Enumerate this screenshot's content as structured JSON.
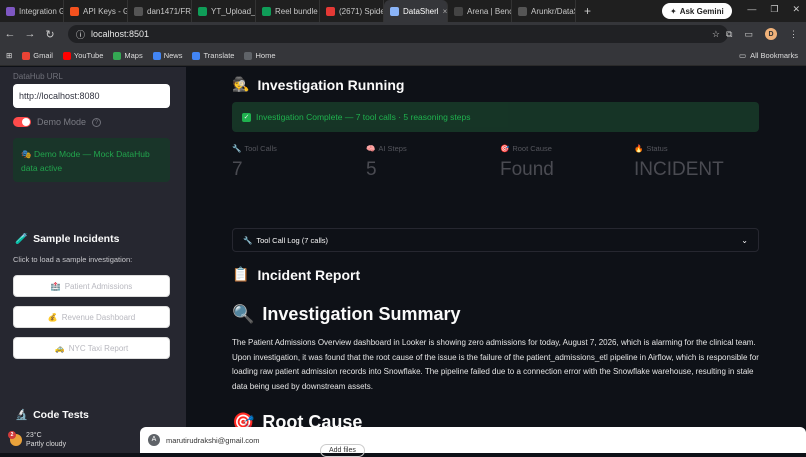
{
  "browser": {
    "tabs": [
      {
        "label": "Integration Gu",
        "color": "#7e57c2"
      },
      {
        "label": "API Keys - Gro",
        "color": "#f4511e"
      },
      {
        "label": "dan1471/FREE",
        "color": "#555555"
      },
      {
        "label": "YT_Upload_Co",
        "color": "#0f9d58"
      },
      {
        "label": "Reel bundle -",
        "color": "#0f9d58"
      },
      {
        "label": "(2671) Spider-",
        "color": "#e53935"
      },
      {
        "label": "DataSherl",
        "color": "#8ab4f8",
        "active": true
      },
      {
        "label": "Arena | Bench",
        "color": "#444444"
      },
      {
        "label": "Arunkr/DataSh",
        "color": "#555555"
      }
    ],
    "new_tab": "+",
    "gemini_label": "Ask Gemini",
    "url": "localhost:8501",
    "profile_initial": "D",
    "bookmarks": [
      {
        "label": "Gmail",
        "color": "#ea4335"
      },
      {
        "label": "YouTube",
        "color": "#ff0000"
      },
      {
        "label": "Maps",
        "color": "#34a853"
      },
      {
        "label": "News",
        "color": "#4285f4"
      },
      {
        "label": "Translate",
        "color": "#4285f4"
      },
      {
        "label": "Home",
        "color": "#5f6368"
      }
    ],
    "all_bookmarks": "All Bookmarks"
  },
  "sidebar": {
    "datahub_label": "DataHub URL",
    "datahub_value": "http://localhost:8080",
    "demo_mode_label": "Demo Mode",
    "demo_info": "Demo Mode — Mock DataHub data active",
    "sample_heading": "Sample Incidents",
    "sample_sub": "Click to load a sample investigation:",
    "samples": [
      "Patient Admissions",
      "Revenue Dashboard",
      "NYC Taxi Report"
    ],
    "code_tests_heading": "Code Tests"
  },
  "main": {
    "running_heading": "Investigation Running",
    "complete_msg": "Investigation Complete — 7 tool calls · 5 reasoning steps",
    "metrics": [
      {
        "label": "Tool Calls",
        "value": "7",
        "icon": "wrench-icon"
      },
      {
        "label": "AI Steps",
        "value": "5",
        "icon": "brain-icon"
      },
      {
        "label": "Root Cause",
        "value": "Found",
        "icon": "target-icon"
      },
      {
        "label": "Status",
        "value": "INCIDENT",
        "icon": "fire-icon"
      }
    ],
    "tool_log": "Tool Call Log (7 calls)",
    "incident_report": "Incident Report",
    "summary_heading": "Investigation Summary",
    "summary_text": "The Patient Admissions Overview dashboard in Looker is showing zero admissions for today, August 7, 2026, which is alarming for the clinical team. Upon investigation, it was found that the root cause of the issue is the failure of the patient_admissions_etl pipeline in Airflow, which is responsible for loading raw patient admission records into Snowflake. The pipeline failed due to a connection error with the Snowflake warehouse, resulting in stale data being used by downstream assets.",
    "root_cause_heading": "Root Cause"
  },
  "taskbar": {
    "temp": "23°C",
    "weather": "Partly cloudy",
    "alert_count": "2"
  },
  "gmail_popup": {
    "email": "marutirudrakshi@gmail.com",
    "avatar": "A",
    "add_files": "Add files"
  }
}
